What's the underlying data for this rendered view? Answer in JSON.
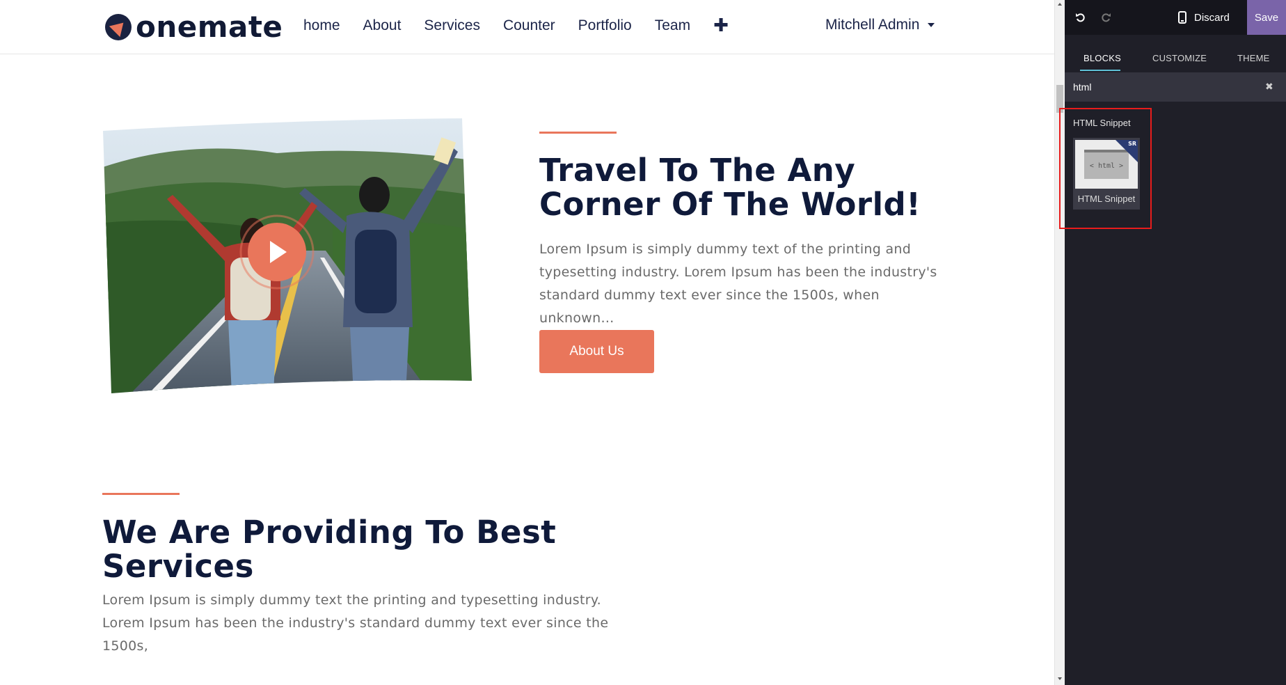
{
  "navbar": {
    "logo_text": "onemate",
    "links": [
      "home",
      "About",
      "Services",
      "Counter",
      "Portfolio",
      "Team"
    ],
    "plus_icon": "plus-icon",
    "user_name": "Mitchell Admin"
  },
  "hero": {
    "title": "Travel To The Any Corner Of The World!",
    "text": "Lorem Ipsum is simply dummy text of the printing and typesetting industry. Lorem Ipsum has been the industry's standard dummy text ever since the 1500s, when unknown…",
    "button_label": "About Us",
    "image_icon": "play-icon"
  },
  "services": {
    "title": "We Are Providing To Best Services",
    "text": "Lorem Ipsum is simply dummy text the printing and typesetting industry. Lorem Ipsum has been the industry's standard dummy text ever since the 1500s,"
  },
  "editor": {
    "discard_label": "Discard",
    "save_label": "Save",
    "tabs": [
      "BLOCKS",
      "CUSTOMIZE",
      "THEME"
    ],
    "active_tab": "BLOCKS",
    "search": {
      "value": "html",
      "placeholder": ""
    },
    "group_title": "HTML Snippet",
    "snippet": {
      "thumb_text": "< html >",
      "badge": "SR",
      "label": "HTML Snippet"
    }
  },
  "colors": {
    "accent": "#e9765b",
    "heading": "#0f1a3a",
    "editor_bg": "#1f1f28",
    "save_bg": "#7a64a9",
    "highlight": "#e81c1c"
  }
}
